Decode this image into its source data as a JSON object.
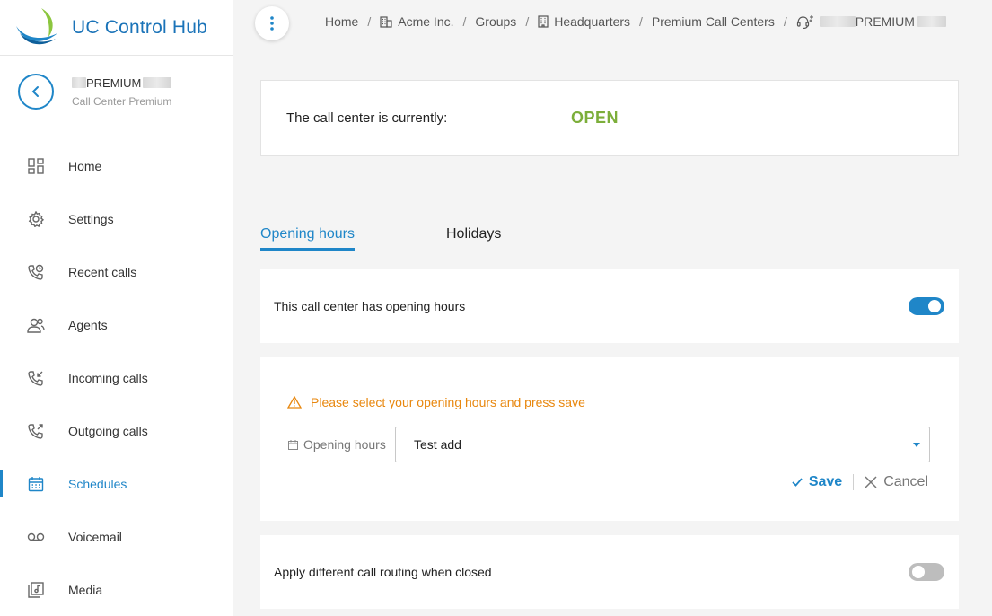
{
  "app": {
    "title": "UC Control Hub"
  },
  "context": {
    "title_visible": "PREMIUM",
    "subtitle": "Call Center Premium"
  },
  "nav": [
    {
      "label": "Home",
      "icon": "dashboard-icon",
      "active": false
    },
    {
      "label": "Settings",
      "icon": "gear-icon",
      "active": false
    },
    {
      "label": "Recent calls",
      "icon": "phone-history-icon",
      "active": false
    },
    {
      "label": "Agents",
      "icon": "agents-icon",
      "active": false
    },
    {
      "label": "Incoming calls",
      "icon": "phone-incoming-icon",
      "active": false
    },
    {
      "label": "Outgoing calls",
      "icon": "phone-outgoing-icon",
      "active": false
    },
    {
      "label": "Schedules",
      "icon": "calendar-icon",
      "active": true
    },
    {
      "label": "Voicemail",
      "icon": "voicemail-icon",
      "active": false
    },
    {
      "label": "Media",
      "icon": "media-icon",
      "active": false
    }
  ],
  "breadcrumb": {
    "home": "Home",
    "company": "Acme Inc.",
    "groups": "Groups",
    "group": "Headquarters",
    "section": "Premium Call Centers",
    "current_visible": "PREMIUM"
  },
  "status": {
    "label": "The call center is currently:",
    "value": "OPEN"
  },
  "tabs": {
    "opening_hours": "Opening hours",
    "holidays": "Holidays"
  },
  "opening_hours_toggle": {
    "label": "This call center has opening hours",
    "enabled": true
  },
  "opening_form": {
    "warning": "Please select your opening hours and press save",
    "field_label": "Opening hours",
    "selected": "Test add",
    "save_label": "Save",
    "cancel_label": "Cancel"
  },
  "closed_routing_toggle": {
    "label": "Apply different call routing when closed",
    "enabled": false
  },
  "colors": {
    "accent": "#1f86c8",
    "open": "#7cae3a",
    "warning": "#e8870e"
  }
}
